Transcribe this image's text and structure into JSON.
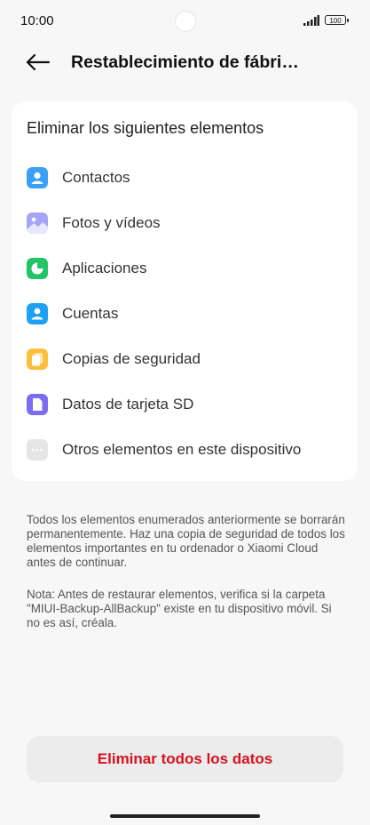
{
  "status_bar": {
    "time": "10:00",
    "battery": "100"
  },
  "header": {
    "title": "Restablecimiento de fábri…"
  },
  "card": {
    "title": "Eliminar los siguientes elementos",
    "items": [
      {
        "label": "Contactos",
        "icon": "contact-icon",
        "color": "#3aa0f5"
      },
      {
        "label": "Fotos y vídeos",
        "icon": "gallery-icon",
        "color": "#8f8df2"
      },
      {
        "label": "Aplicaciones",
        "icon": "apps-icon",
        "color": "#22c466"
      },
      {
        "label": "Cuentas",
        "icon": "account-icon",
        "color": "#1ea1f2"
      },
      {
        "label": "Copias de seguridad",
        "icon": "backup-icon",
        "color": "#fbbf3c"
      },
      {
        "label": "Datos de tarjeta SD",
        "icon": "sdcard-icon",
        "color": "#7b6cf0"
      },
      {
        "label": "Otros elementos en este dispositivo",
        "icon": "more-icon",
        "color": "#e6e6e6"
      }
    ]
  },
  "notes": {
    "warning": "Todos los elementos enumerados anteriormente se borrarán permanentemente. Haz una copia de seguridad de todos los elementos importantes en tu ordenador o Xiaomi Cloud antes de continuar.",
    "tip": "Nota: Antes de restaurar elementos, verifica si la carpeta \"MIUI-Backup-AllBackup\" existe en tu dispositivo móvil. Si no es así, créala."
  },
  "actions": {
    "erase_label": "Eliminar todos los datos"
  }
}
